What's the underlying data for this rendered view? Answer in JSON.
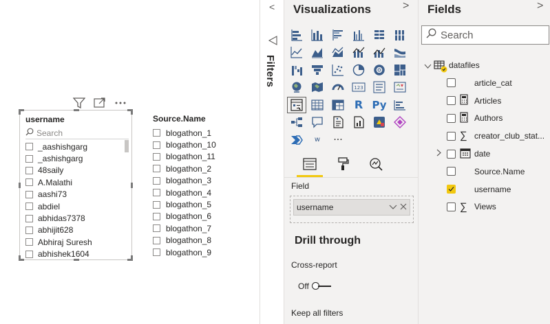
{
  "canvas": {
    "slicer1": {
      "title": "username",
      "search_placeholder": "Search",
      "items": [
        "_aashishgarg",
        "_ashishgarg",
        "48saily",
        "A.Malathi",
        "aashi73",
        "abdiel",
        "abhidas7378",
        "abhijit628",
        "Abhiraj Suresh",
        "abhishek1604"
      ]
    },
    "slicer2": {
      "title": "Source.Name",
      "items": [
        "blogathon_1",
        "blogathon_10",
        "blogathon_11",
        "blogathon_2",
        "blogathon_3",
        "blogathon_4",
        "blogathon_5",
        "blogathon_6",
        "blogathon_7",
        "blogathon_8",
        "blogathon_9"
      ]
    },
    "visual_header_icons": [
      "filter-icon",
      "focus-mode-icon",
      "more-options-icon"
    ]
  },
  "filters_pane": {
    "label": "Filters",
    "collapse_glyph": "<"
  },
  "visualizations_pane": {
    "title": "Visualizations",
    "chevron": ">",
    "text_icons": {
      "r": "R",
      "py": "Py",
      "w": "w",
      "more": "···"
    },
    "field_label": "Field",
    "field_value": "username",
    "drill_title": "Drill through",
    "cross_report_label": "Cross-report",
    "toggle_state": "Off",
    "keep_filters_label": "Keep all filters"
  },
  "fields_pane": {
    "title": "Fields",
    "chevron": ">",
    "search_placeholder": "Search",
    "table_name": "datafiles",
    "fields": [
      {
        "name": "article_cat",
        "icon": "none",
        "checked": false,
        "expandable": false
      },
      {
        "name": "Articles",
        "icon": "calculator-icon",
        "checked": false,
        "expandable": false
      },
      {
        "name": "Authors",
        "icon": "calculator-icon",
        "checked": false,
        "expandable": false
      },
      {
        "name": "creator_club_stat...",
        "icon": "sigma-icon",
        "checked": false,
        "expandable": false
      },
      {
        "name": "date",
        "icon": "calendar-icon",
        "checked": false,
        "expandable": true
      },
      {
        "name": "Source.Name",
        "icon": "none",
        "checked": false,
        "expandable": false
      },
      {
        "name": "username",
        "icon": "none",
        "checked": true,
        "expandable": false
      },
      {
        "name": "Views",
        "icon": "sigma-icon",
        "checked": false,
        "expandable": false
      }
    ]
  },
  "colors": {
    "accent_yellow": "#f2c80f",
    "pane_background": "#f3f2f1",
    "icon_blue": "#3c5e8b"
  }
}
